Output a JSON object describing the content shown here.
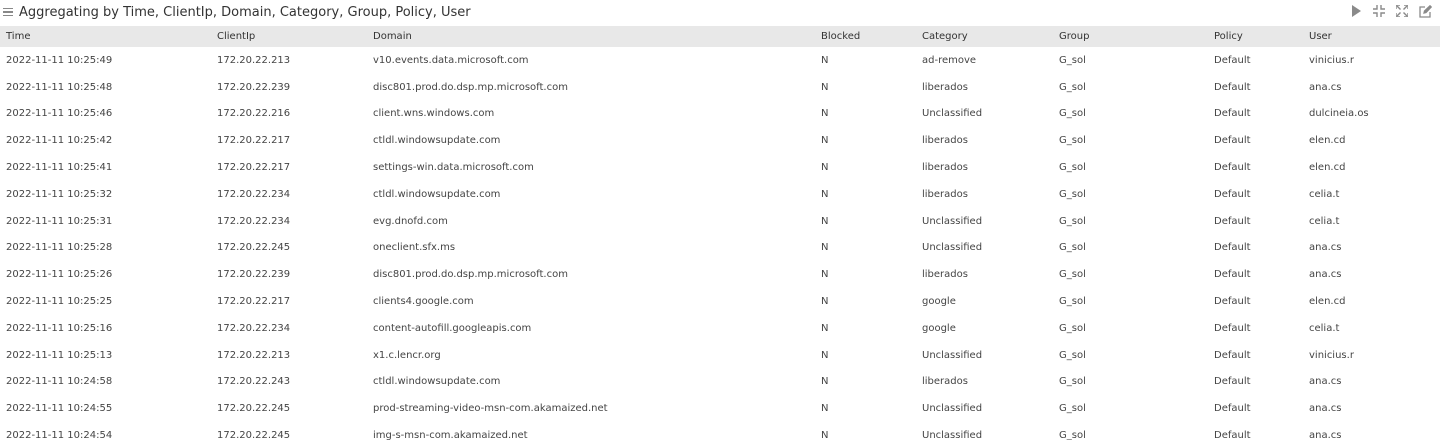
{
  "panel": {
    "title": "Aggregating by Time, ClientIp, Domain, Category, Group, Policy, User",
    "tools": [
      "play-icon",
      "collapse-icon",
      "expand-icon",
      "edit-icon"
    ]
  },
  "table": {
    "columns": [
      "Time",
      "ClientIp",
      "Domain",
      "Blocked",
      "Category",
      "Group",
      "Policy",
      "User"
    ],
    "rows": [
      [
        "2022-11-11 10:25:49",
        "172.20.22.213",
        "v10.events.data.microsoft.com",
        "N",
        "ad-remove",
        "G_sol",
        "Default",
        "vinicius.r"
      ],
      [
        "2022-11-11 10:25:48",
        "172.20.22.239",
        "disc801.prod.do.dsp.mp.microsoft.com",
        "N",
        "liberados",
        "G_sol",
        "Default",
        "ana.cs"
      ],
      [
        "2022-11-11 10:25:46",
        "172.20.22.216",
        "client.wns.windows.com",
        "N",
        "Unclassified",
        "G_sol",
        "Default",
        "dulcineia.os"
      ],
      [
        "2022-11-11 10:25:42",
        "172.20.22.217",
        "ctldl.windowsupdate.com",
        "N",
        "liberados",
        "G_sol",
        "Default",
        "elen.cd"
      ],
      [
        "2022-11-11 10:25:41",
        "172.20.22.217",
        "settings-win.data.microsoft.com",
        "N",
        "liberados",
        "G_sol",
        "Default",
        "elen.cd"
      ],
      [
        "2022-11-11 10:25:32",
        "172.20.22.234",
        "ctldl.windowsupdate.com",
        "N",
        "liberados",
        "G_sol",
        "Default",
        "celia.t"
      ],
      [
        "2022-11-11 10:25:31",
        "172.20.22.234",
        "evg.dnofd.com",
        "N",
        "Unclassified",
        "G_sol",
        "Default",
        "celia.t"
      ],
      [
        "2022-11-11 10:25:28",
        "172.20.22.245",
        "oneclient.sfx.ms",
        "N",
        "Unclassified",
        "G_sol",
        "Default",
        "ana.cs"
      ],
      [
        "2022-11-11 10:25:26",
        "172.20.22.239",
        "disc801.prod.do.dsp.mp.microsoft.com",
        "N",
        "liberados",
        "G_sol",
        "Default",
        "ana.cs"
      ],
      [
        "2022-11-11 10:25:25",
        "172.20.22.217",
        "clients4.google.com",
        "N",
        "google",
        "G_sol",
        "Default",
        "elen.cd"
      ],
      [
        "2022-11-11 10:25:16",
        "172.20.22.234",
        "content-autofill.googleapis.com",
        "N",
        "google",
        "G_sol",
        "Default",
        "celia.t"
      ],
      [
        "2022-11-11 10:25:13",
        "172.20.22.213",
        "x1.c.lencr.org",
        "N",
        "Unclassified",
        "G_sol",
        "Default",
        "vinicius.r"
      ],
      [
        "2022-11-11 10:24:58",
        "172.20.22.243",
        "ctldl.windowsupdate.com",
        "N",
        "liberados",
        "G_sol",
        "Default",
        "ana.cs"
      ],
      [
        "2022-11-11 10:24:55",
        "172.20.22.245",
        "prod-streaming-video-msn-com.akamaized.net",
        "N",
        "Unclassified",
        "G_sol",
        "Default",
        "ana.cs"
      ],
      [
        "2022-11-11 10:24:54",
        "172.20.22.245",
        "img-s-msn-com.akamaized.net",
        "N",
        "Unclassified",
        "G_sol",
        "Default",
        "ana.cs"
      ]
    ]
  },
  "colors": {
    "header_bg": "#e8e8e8",
    "text": "#333333",
    "icon": "#8a8a8a"
  }
}
